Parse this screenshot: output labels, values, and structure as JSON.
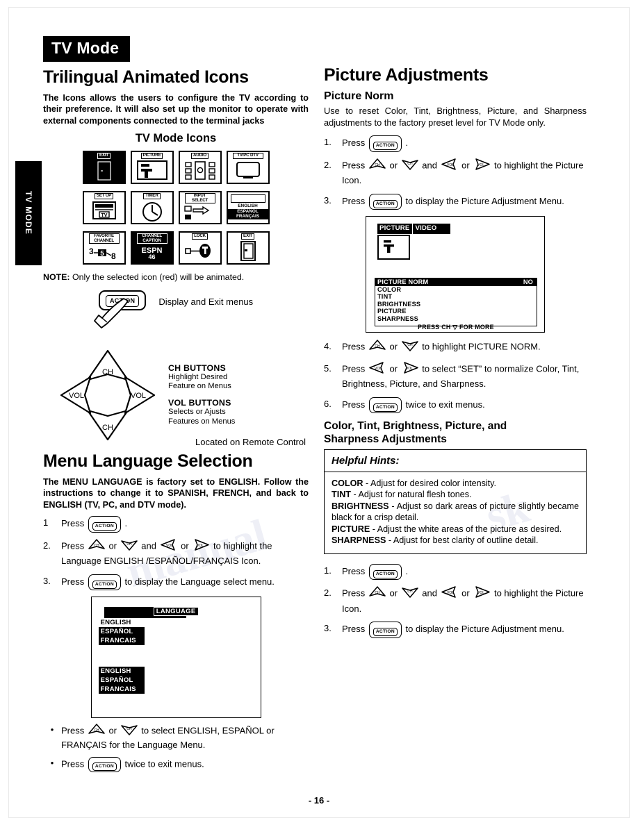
{
  "page": {
    "number_label": "- 16 -",
    "side_tab": "TV MODE",
    "mode_chip": "TV Mode"
  },
  "left": {
    "heading": "Trilingual Animated Icons",
    "intro": "The Icons allows the users to configure the TV according to their preference. It will also set up the monitor to operate with external components connected to the terminal jacks",
    "icons_title": "TV Mode Icons",
    "icons": [
      {
        "name": "exit-icon",
        "caption": "EXIT",
        "selected": true
      },
      {
        "name": "picture-icon",
        "caption": "PICTURE",
        "selected": false
      },
      {
        "name": "audio-icon",
        "caption": "AUDIO",
        "selected": false
      },
      {
        "name": "tv-pc-dtv-icon",
        "caption": "TV/PC DTV",
        "selected": false
      },
      {
        "name": "set-up-icon",
        "caption": "SET UP",
        "selected": false,
        "sub": "TV"
      },
      {
        "name": "timer-icon",
        "caption": "TIMER",
        "selected": false
      },
      {
        "name": "input-select-icon",
        "caption": "INPUT SELECT",
        "selected": false
      },
      {
        "name": "language-icon",
        "caption": "",
        "selected": false,
        "languages": [
          "ENGLISH",
          "ESPAÑOL",
          "FRANÇAIS"
        ]
      },
      {
        "name": "favorite-channel-icon",
        "caption": "FAVORITE CHANNEL",
        "selected": false,
        "channels": [
          "3",
          "5",
          "8"
        ]
      },
      {
        "name": "channel-caption-icon",
        "caption": "CHANNEL CAPTION",
        "selected": false,
        "station": "ESPN",
        "channel": "46"
      },
      {
        "name": "lock-icon",
        "caption": "LOCK",
        "selected": false
      },
      {
        "name": "exit-door-icon",
        "caption": "EXIT",
        "selected": false
      }
    ],
    "note_label": "NOTE:",
    "note_text": " Only the selected icon (red) will be animated.",
    "action_key": "ACTION",
    "action_caption": "Display and Exit menus",
    "pad": {
      "up_label": "CH",
      "down_label": "CH",
      "left_label": "VOL",
      "right_label": "VOL",
      "ch_title": "CH  BUTTONS",
      "ch_desc_1": "Highlight Desired",
      "ch_desc_2": "Feature on Menus",
      "vol_title": "VOL  BUTTONS",
      "vol_desc_1": "Selects or Ajusts",
      "vol_desc_2": "Features on Menus",
      "located": "Located on Remote Control"
    },
    "language_section": {
      "heading": "Menu Language Selection",
      "intro": "The MENU LANGUAGE is factory set to ENGLISH. Follow the instructions to change it to SPANISH, FRENCH, and back to ENGLISH (TV, PC, and DTV mode).",
      "steps": [
        {
          "n": "1",
          "pre": "Press ",
          "post": " ."
        },
        {
          "n": "2.",
          "pre": "Press ",
          "mid1": " or ",
          "mid2": " and ",
          "mid3": " or ",
          "post": " to highlight the   Language ENGLISH /ESPAÑOL/FRANÇAIS Icon."
        },
        {
          "n": "3.",
          "pre": "Press ",
          "post": " to display the Language select menu."
        }
      ],
      "osd": {
        "header": "LANGUAGE",
        "group_top": [
          {
            "label": "ENGLISH",
            "selected": false
          },
          {
            "label": "ESPAÑOL",
            "selected": true
          },
          {
            "label": "FRANCAIS",
            "selected": true
          }
        ],
        "group_bottom": [
          {
            "label": "ENGLISH",
            "selected": true
          },
          {
            "label": "ESPAÑOL",
            "selected": true
          },
          {
            "label": "FRANCAIS",
            "selected": true
          }
        ]
      },
      "bullets": [
        {
          "n": "•",
          "pre": "Press ",
          "mid1": " or ",
          "post": " to select ENGLISH, ESPAÑOL or FRANÇAIS for the Language Menu."
        },
        {
          "n": "•",
          "pre": "Press ",
          "post": " twice to exit menus."
        }
      ]
    }
  },
  "right": {
    "heading": "Picture Adjustments",
    "sub_heading": "Picture Norm",
    "intro": "Use to reset Color, Tint, Brightness, Picture, and Sharpness adjustments to the factory preset level for TV Mode only.",
    "steps_top": [
      {
        "n": "1.",
        "pre": "Press ",
        "post": " ."
      },
      {
        "n": "2.",
        "pre": "Press ",
        "mid1": " or ",
        "mid2": " and ",
        "mid3": " or ",
        "post": " to highlight the Picture Icon."
      },
      {
        "n": "3.",
        "pre": "Press ",
        "post": " to display the Picture Adjustment Menu."
      }
    ],
    "osd": {
      "tab_active": "PICTURE",
      "tab_other": "VIDEO",
      "rows": [
        {
          "label": "PICTURE NORM",
          "value": "NO",
          "selected": true
        },
        {
          "label": "COLOR",
          "value": "",
          "selected": false
        },
        {
          "label": "TINT",
          "value": "",
          "selected": false
        },
        {
          "label": "BRIGHTNESS",
          "value": "",
          "selected": false
        },
        {
          "label": "PICTURE",
          "value": "",
          "selected": false
        },
        {
          "label": "SHARPNESS",
          "value": "",
          "selected": false
        }
      ],
      "footer": "PRESS CH ▽ FOR MORE"
    },
    "steps_mid": [
      {
        "n": "4.",
        "pre": "Press ",
        "mid1": " or ",
        "post": " to highlight PICTURE NORM."
      },
      {
        "n": "5.",
        "pre": "Press ",
        "mid1": " or ",
        "post": " to select “SET” to normalize Color, Tint, Brightness, Picture, and Sharpness."
      },
      {
        "n": "6.",
        "pre": "Press ",
        "post": " twice to exit menus."
      }
    ],
    "adjust_heading_1": "Color, Tint, Brightness, Picture, and",
    "adjust_heading_2": "Sharpness Adjustments",
    "hints": {
      "title": "Helpful Hints:",
      "items": [
        {
          "term": "COLOR",
          "text": " - Adjust for desired color intensity."
        },
        {
          "term": "TINT",
          "text": " - Adjust for natural flesh tones."
        },
        {
          "term": "BRIGHTNESS",
          "text": " - Adjust so dark areas of picture slightly became black for a crisp detail."
        },
        {
          "term": "PICTURE",
          "text": " - Adjust the white areas of the picture as desired."
        },
        {
          "term": "SHARPNESS",
          "text": " - Adjust for best clarity of outline detail."
        }
      ]
    },
    "steps_bottom": [
      {
        "n": "1.",
        "pre": "Press ",
        "post": " ."
      },
      {
        "n": "2.",
        "pre": "Press ",
        "mid1": " or ",
        "mid2": " and ",
        "mid3": " or ",
        "post": " to highlight the Picture Icon."
      },
      {
        "n": "3.",
        "pre": "Press ",
        "post": " to display the Picture Adjustment menu."
      }
    ]
  },
  "keys": {
    "action": "ACTION",
    "ch_up": "CH",
    "ch_down": "CH",
    "vol_left": "VOL",
    "vol_right": "VOL"
  }
}
